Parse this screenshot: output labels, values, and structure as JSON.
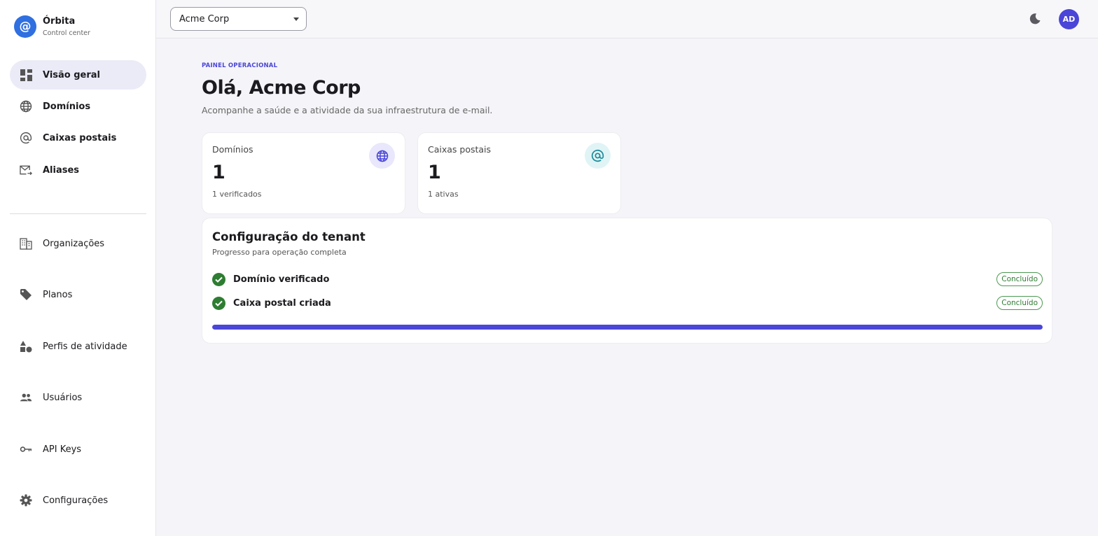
{
  "brand": {
    "name": "Órbita",
    "subtitle": "Control center",
    "logo_glyph": "@"
  },
  "sidebar": {
    "primary": [
      {
        "label": "Visão geral",
        "icon": "dashboard-icon",
        "active": true
      },
      {
        "label": "Domínios",
        "icon": "globe-icon"
      },
      {
        "label": "Caixas postais",
        "icon": "at-icon"
      },
      {
        "label": "Aliases",
        "icon": "mail-forward-icon"
      }
    ],
    "secondary": [
      {
        "label": "Organizações",
        "icon": "building-icon"
      },
      {
        "label": "Planos",
        "icon": "tag-icon"
      },
      {
        "label": "Perfis de atividade",
        "icon": "shapes-icon"
      },
      {
        "label": "Usuários",
        "icon": "users-icon"
      },
      {
        "label": "API Keys",
        "icon": "key-icon"
      },
      {
        "label": "Configurações",
        "icon": "gear-icon"
      }
    ]
  },
  "topbar": {
    "tenant": "Acme Corp",
    "theme_icon": "moon-icon",
    "avatar_initials": "AD"
  },
  "main": {
    "eyebrow": "PAINEL OPERACIONAL",
    "greeting": "Olá, Acme Corp",
    "subtitle": "Acompanhe a saúde e a atividade da sua infraestrutura de e-mail."
  },
  "stats": [
    {
      "title": "Domínios",
      "value": "1",
      "foot": "1 verificados",
      "icon": "globe-icon",
      "badge_bg": "#e8e7fb",
      "icon_color": "#4a46d8"
    },
    {
      "title": "Caixas postais",
      "value": "1",
      "foot": "1 ativas",
      "icon": "at-icon",
      "badge_bg": "#e0f4f6",
      "icon_color": "#1a8a9a"
    }
  ],
  "setup": {
    "title": "Configuração do tenant",
    "subtitle": "Progresso para operação completa",
    "steps": [
      {
        "label": "Domínio verificado",
        "status": "Concluído"
      },
      {
        "label": "Caixa postal criada",
        "status": "Concluído"
      }
    ],
    "progress_percent": 100
  },
  "colors": {
    "accent": "#4a46d8",
    "success": "#2e7d32",
    "brand": "#2f6fe0"
  }
}
